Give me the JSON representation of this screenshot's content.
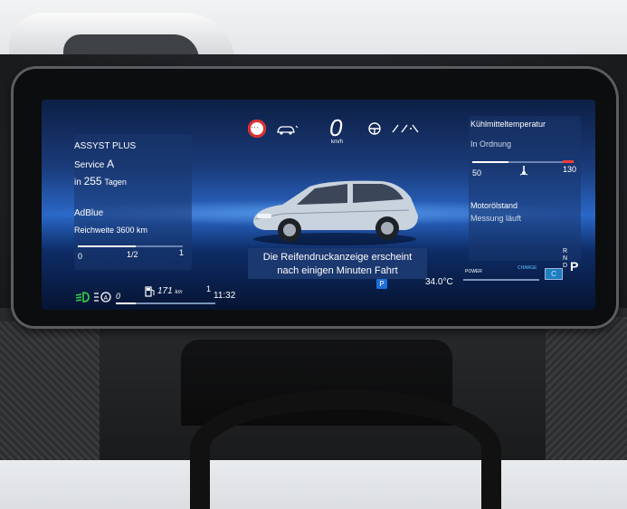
{
  "left_panel": {
    "assyst_title": "ASSYST PLUS",
    "service_label": "Service",
    "service_value": "A",
    "days_prefix": "in",
    "days_value": "255",
    "days_unit": "Tagen",
    "adblue_title": "AdBlue",
    "range_label": "Reichweite 3600 km",
    "scale": [
      "0",
      "1/2",
      "1"
    ],
    "adblue_level": 0.55
  },
  "top_bar": {
    "speed": "0",
    "speed_unit": "km/h",
    "limit_sign": "no-limit-sign-icon"
  },
  "right_panel": {
    "coolant_title": "Kühlmitteltemperatur",
    "coolant_status": "In Ordnung",
    "scale_min": "50",
    "scale_max": "130",
    "oil_title": "Motorölstand",
    "oil_status": "Messung läuft"
  },
  "message": {
    "line1": "Die Reifendruckanzeige erscheint",
    "line2": "nach einigen Minuten Fahrt",
    "badge": "P"
  },
  "bottom_bar": {
    "trip": "0",
    "range_value": "171",
    "range_unit": "km",
    "time": "11:32",
    "outside_temp": "34.0°C",
    "power_label": "POWER",
    "charge_label": "CHARGE",
    "charge_badge": "C",
    "gear_selector": [
      "R",
      "N",
      "D"
    ],
    "gear_current": "P",
    "fuel_marker": "1"
  },
  "colors": {
    "warning_red": "#e12b2b",
    "lamp_green": "#34d14a",
    "accent_blue": "#1e6fd8"
  }
}
